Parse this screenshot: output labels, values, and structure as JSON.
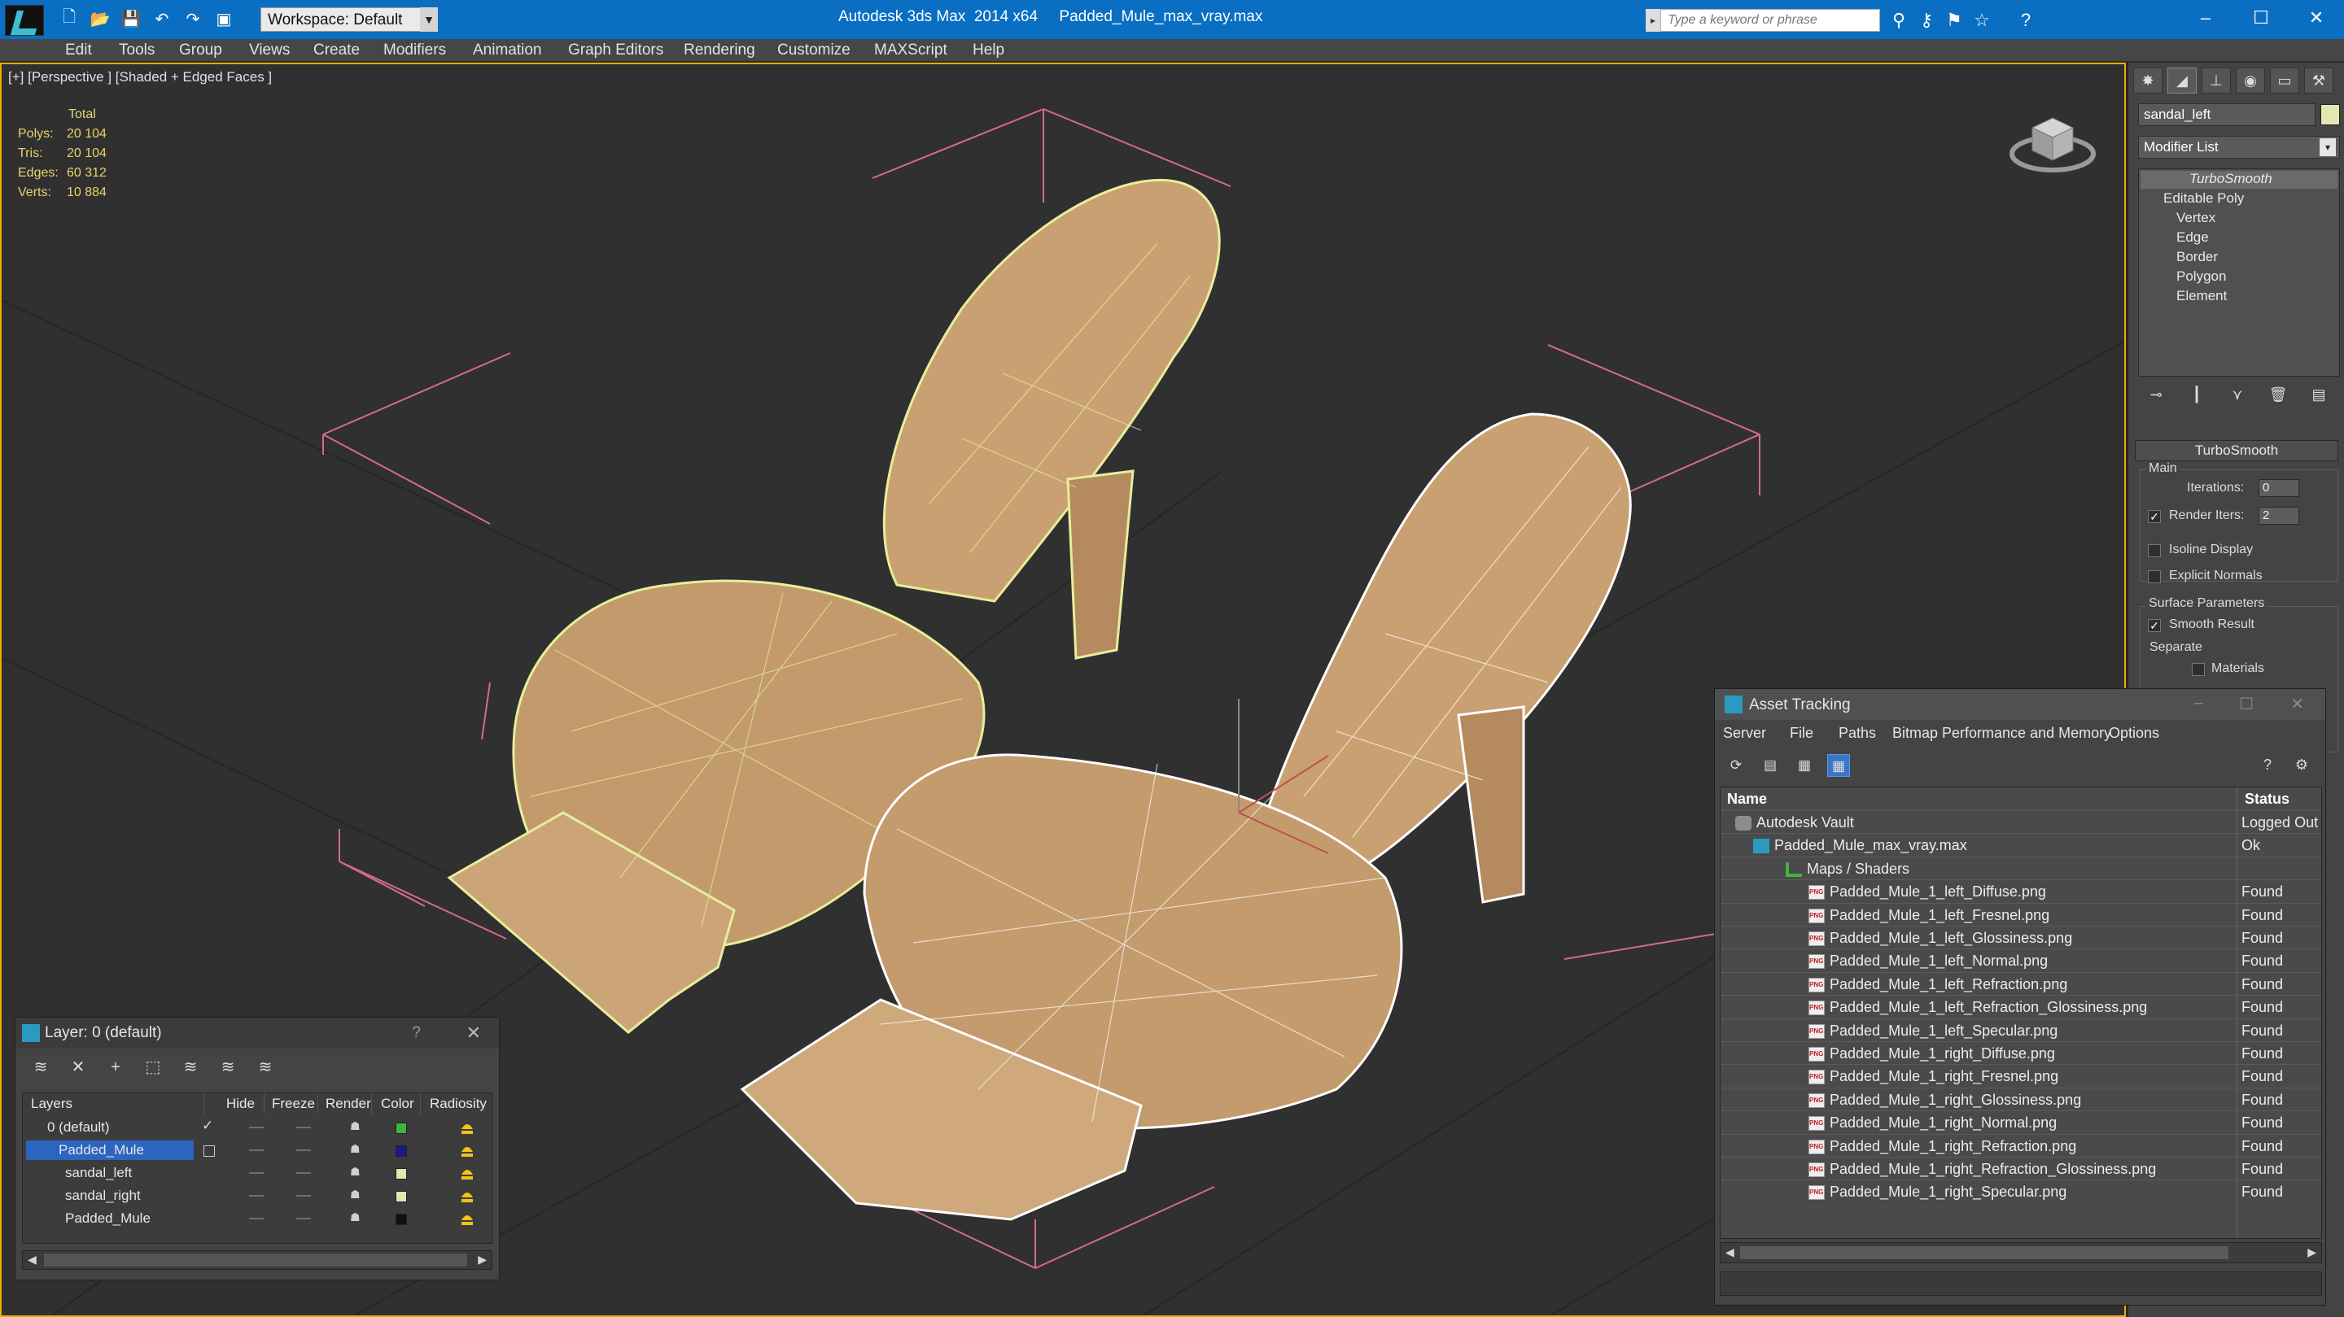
{
  "titlebar": {
    "workspace_label": "Workspace: Default",
    "app_title": "Autodesk 3ds Max  2014 x64     Padded_Mule_max_vray.max",
    "search_placeholder": "Type a keyword or phrase"
  },
  "menu": [
    "Edit",
    "Tools",
    "Group",
    "Views",
    "Create",
    "Modifiers",
    "Animation",
    "Graph Editors",
    "Rendering",
    "Customize",
    "MAXScript",
    "Help"
  ],
  "viewport": {
    "label": "[+] [Perspective ] [Shaded + Edged Faces ]",
    "stats": {
      "header": "Total",
      "rows": [
        {
          "label": "Polys:",
          "value": "20 104"
        },
        {
          "label": "Tris:",
          "value": "20 104"
        },
        {
          "label": "Edges:",
          "value": "60 312"
        },
        {
          "label": "Verts:",
          "value": "10 884"
        }
      ]
    }
  },
  "command_panel": {
    "object_name": "sandal_left",
    "modifier_list": "Modifier List",
    "stack": [
      "TurboSmooth",
      "Editable Poly",
      "Vertex",
      "Edge",
      "Border",
      "Polygon",
      "Element"
    ],
    "turbosmooth": {
      "rollout": "TurboSmooth",
      "main_group": "Main",
      "iterations_label": "Iterations:",
      "iterations_value": "0",
      "render_iters_label": "Render Iters:",
      "render_iters_value": "2",
      "isoline_label": "Isoline Display",
      "explicit_normals_label": "Explicit Normals",
      "surface_group": "Surface Parameters",
      "smooth_result_label": "Smooth Result",
      "separate_label": "Separate",
      "materials_label": "Materials"
    }
  },
  "layer_dialog": {
    "title": "Layer: 0 (default)",
    "help": "?",
    "columns": [
      "Layers",
      "Hide",
      "Freeze",
      "Render",
      "Color",
      "Radiosity"
    ],
    "rows": [
      {
        "name": "0 (default)",
        "color": "#3fb43f",
        "indent": 1,
        "current": true
      },
      {
        "name": "Padded_Mule",
        "color": "#1a1a8c",
        "indent": 0,
        "selected": true
      },
      {
        "name": "sandal_left",
        "color": "#e2e8b0",
        "indent": 2
      },
      {
        "name": "sandal_right",
        "color": "#e2e8b0",
        "indent": 2
      },
      {
        "name": "Padded_Mule",
        "color": "#111111",
        "indent": 2
      }
    ]
  },
  "asset_dialog": {
    "title": "Asset Tracking",
    "menu": [
      "Server",
      "File",
      "Paths",
      "Bitmap Performance and Memory",
      "Options"
    ],
    "columns": [
      "Name",
      "Status"
    ],
    "rows": [
      {
        "name": "Autodesk Vault",
        "status": "Logged Out",
        "level": 0,
        "icon": "vault"
      },
      {
        "name": "Padded_Mule_max_vray.max",
        "status": "Ok",
        "level": 1,
        "icon": "max"
      },
      {
        "name": "Maps / Shaders",
        "status": "",
        "level": 2,
        "icon": "maps"
      },
      {
        "name": "Padded_Mule_1_left_Diffuse.png",
        "status": "Found",
        "level": 3,
        "icon": "png"
      },
      {
        "name": "Padded_Mule_1_left_Fresnel.png",
        "status": "Found",
        "level": 3,
        "icon": "png"
      },
      {
        "name": "Padded_Mule_1_left_Glossiness.png",
        "status": "Found",
        "level": 3,
        "icon": "png"
      },
      {
        "name": "Padded_Mule_1_left_Normal.png",
        "status": "Found",
        "level": 3,
        "icon": "png"
      },
      {
        "name": "Padded_Mule_1_left_Refraction.png",
        "status": "Found",
        "level": 3,
        "icon": "png"
      },
      {
        "name": "Padded_Mule_1_left_Refraction_Glossiness.png",
        "status": "Found",
        "level": 3,
        "icon": "png"
      },
      {
        "name": "Padded_Mule_1_left_Specular.png",
        "status": "Found",
        "level": 3,
        "icon": "png"
      },
      {
        "name": "Padded_Mule_1_right_Diffuse.png",
        "status": "Found",
        "level": 3,
        "icon": "png"
      },
      {
        "name": "Padded_Mule_1_right_Fresnel.png",
        "status": "Found",
        "level": 3,
        "icon": "png"
      },
      {
        "name": "Padded_Mule_1_right_Glossiness.png",
        "status": "Found",
        "level": 3,
        "icon": "png"
      },
      {
        "name": "Padded_Mule_1_right_Normal.png",
        "status": "Found",
        "level": 3,
        "icon": "png"
      },
      {
        "name": "Padded_Mule_1_right_Refraction.png",
        "status": "Found",
        "level": 3,
        "icon": "png"
      },
      {
        "name": "Padded_Mule_1_right_Refraction_Glossiness.png",
        "status": "Found",
        "level": 3,
        "icon": "png"
      },
      {
        "name": "Padded_Mule_1_right_Specular.png",
        "status": "Found",
        "level": 3,
        "icon": "png"
      }
    ]
  }
}
